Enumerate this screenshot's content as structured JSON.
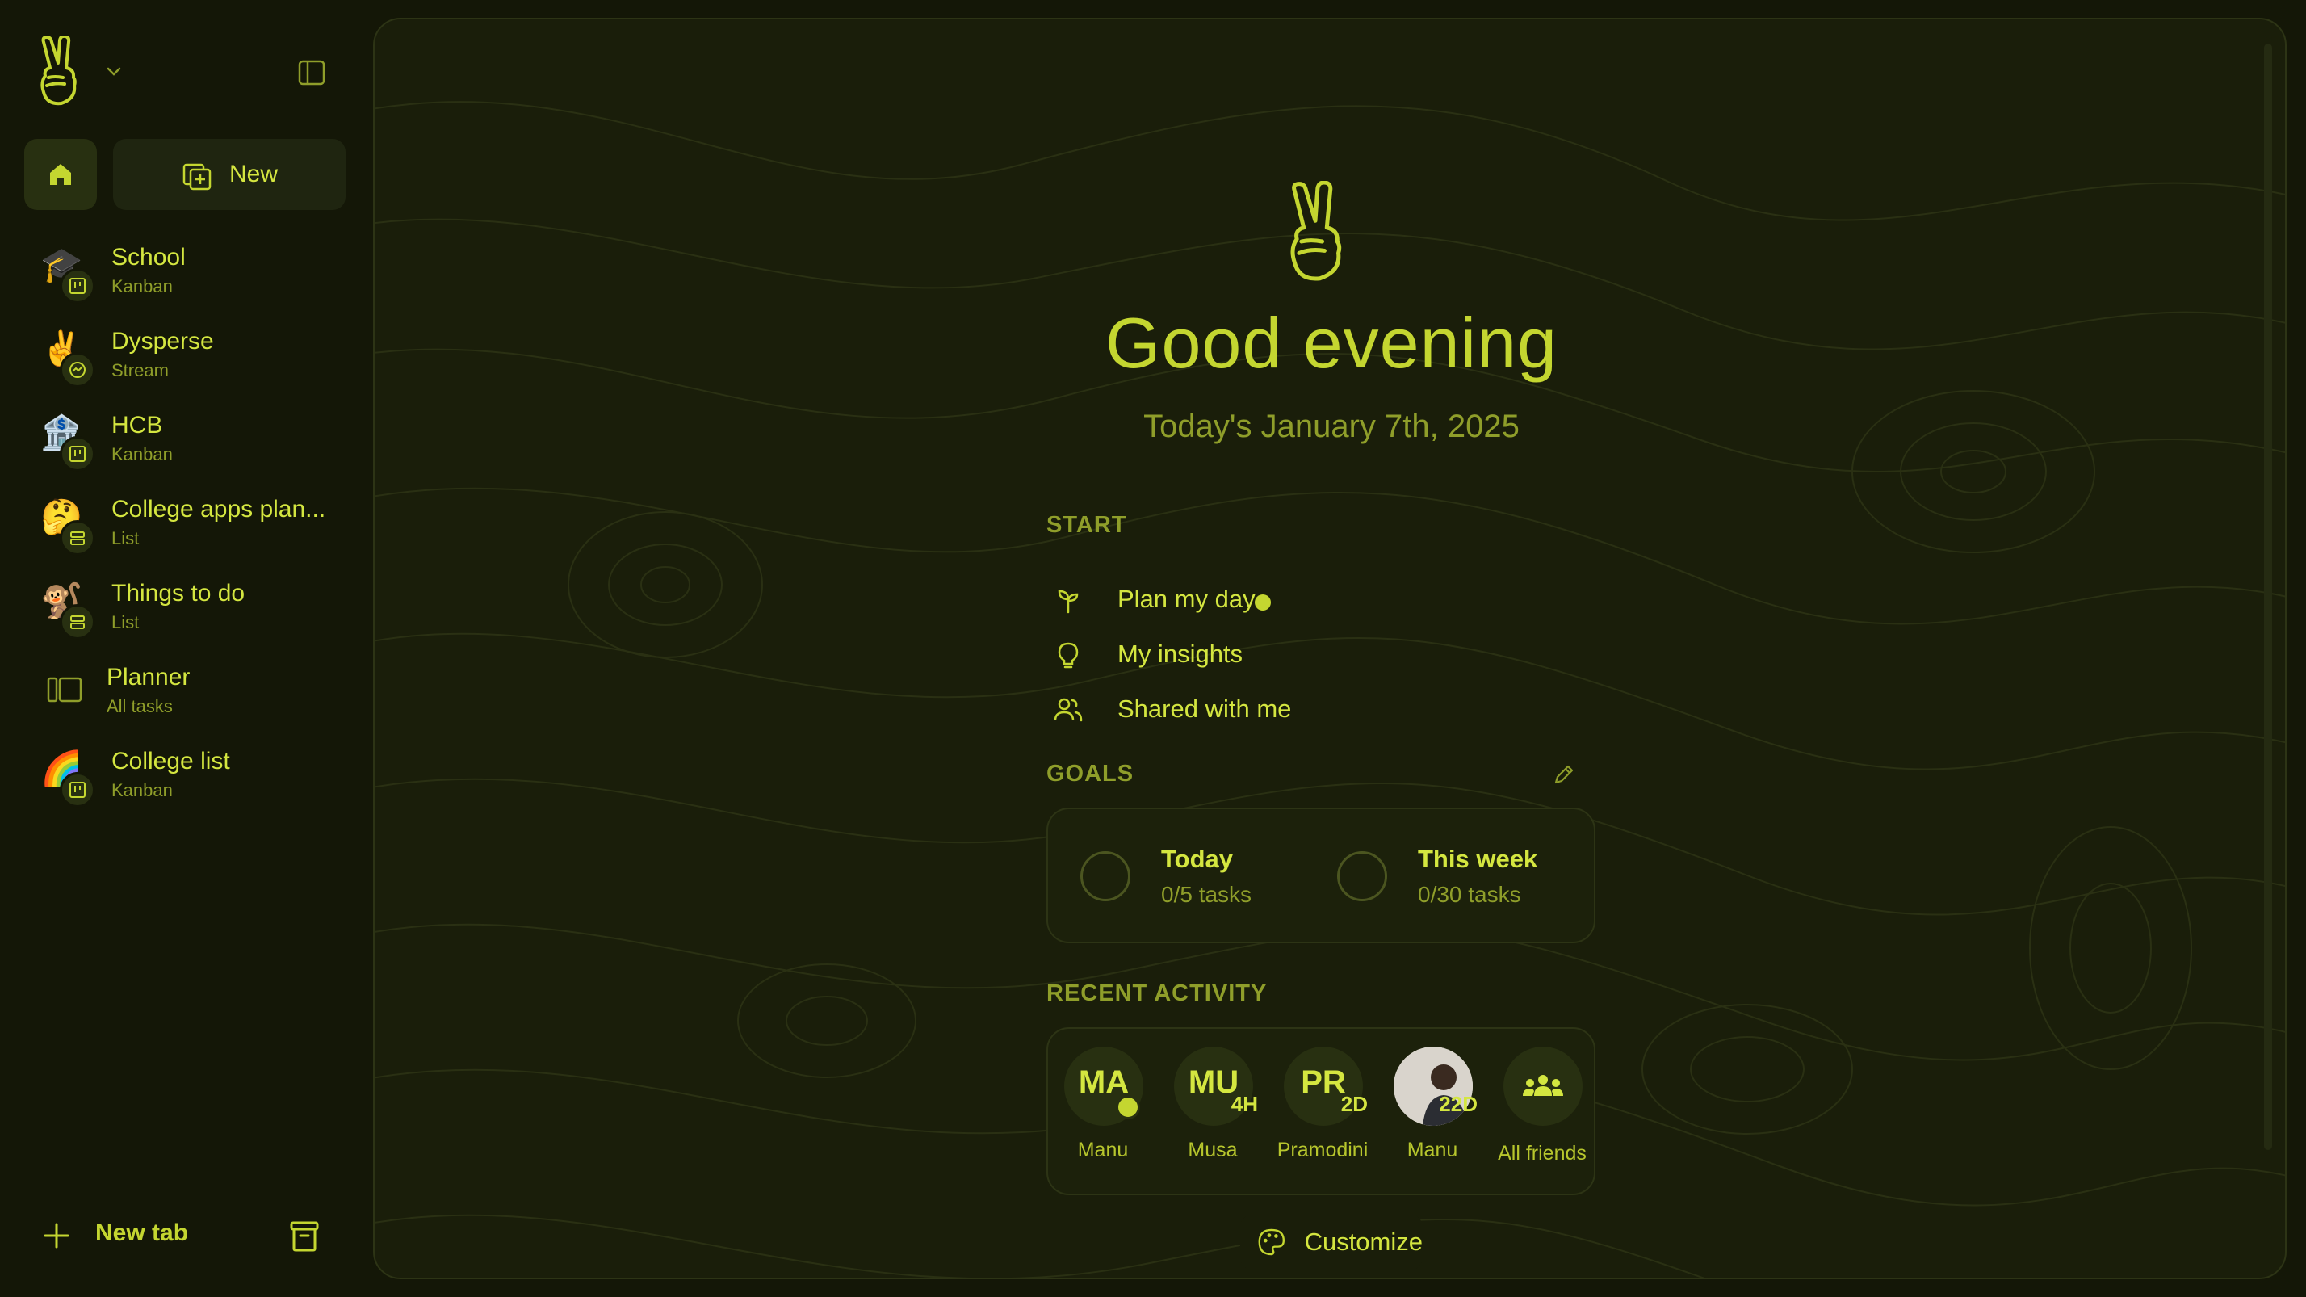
{
  "sidebar": {
    "new_label": "New",
    "items": [
      {
        "emoji": "🎓",
        "title": "School",
        "subtitle": "Kanban",
        "view": "kanban"
      },
      {
        "emoji": "✌️",
        "title": "Dysperse",
        "subtitle": "Stream",
        "view": "stream"
      },
      {
        "emoji": "🏦",
        "title": "HCB",
        "subtitle": "Kanban",
        "view": "kanban"
      },
      {
        "emoji": "🤔",
        "title": "College apps plan...",
        "subtitle": "List",
        "view": "list"
      },
      {
        "emoji": "🐒",
        "title": "Things to do",
        "subtitle": "List",
        "view": "list"
      },
      {
        "emoji": "",
        "title": "Planner",
        "subtitle": "All tasks",
        "view": "planner"
      },
      {
        "emoji": "🌈",
        "title": "College list",
        "subtitle": "Kanban",
        "view": "kanban"
      }
    ],
    "new_tab_label": "New tab"
  },
  "main": {
    "greeting": "Good evening",
    "date": "Today's January 7th, 2025",
    "start": {
      "heading": "START",
      "items": [
        {
          "label": "Plan my day",
          "icon": "sprout-icon"
        },
        {
          "label": "My insights",
          "icon": "lightbulb-icon"
        },
        {
          "label": "Shared with me",
          "icon": "people-icon"
        }
      ]
    },
    "goals": {
      "heading": "GOALS",
      "items": [
        {
          "title": "Today",
          "sub": "0/5 tasks",
          "progress": 0
        },
        {
          "title": "This week",
          "sub": "0/30 tasks",
          "progress": 0
        }
      ]
    },
    "recent": {
      "heading": "RECENT ACTIVITY",
      "friends": [
        {
          "initials": "MA",
          "badge": "",
          "name": "Manu",
          "online": true
        },
        {
          "initials": "MU",
          "badge": "4H",
          "name": "Musa",
          "online": false
        },
        {
          "initials": "PR",
          "badge": "2D",
          "name": "Pramodini",
          "online": false
        },
        {
          "initials": "",
          "badge": "22D",
          "name": "Manu",
          "online": false,
          "photo": true
        },
        {
          "initials": "",
          "badge": "",
          "name": "All friends",
          "online": false
        }
      ]
    },
    "customize_label": "Customize"
  },
  "colors": {
    "accent": "#c4d630",
    "background": "#141707",
    "panel": "#1a1e0a",
    "muted": "#8f9e2a"
  }
}
